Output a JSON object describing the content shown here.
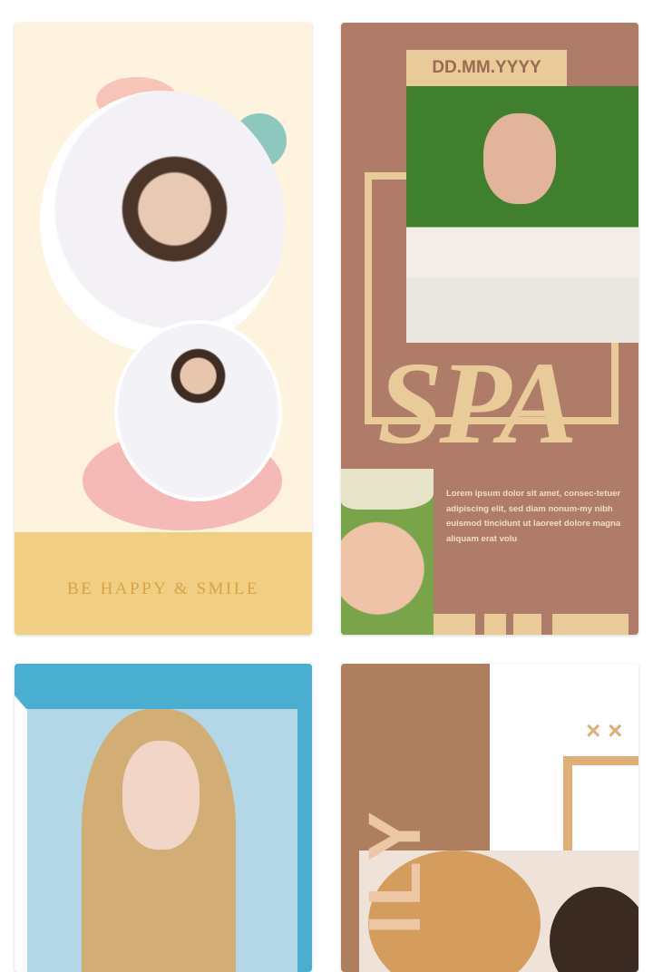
{
  "templates": [
    {
      "name": "be-happy",
      "caption": "BE HAPPY & SMILE",
      "colors": {
        "bg": "#fdf3de",
        "band": "#f0cf85",
        "text": "#d9a441"
      }
    },
    {
      "name": "spa",
      "date_placeholder": "DD.MM.YYYY",
      "title": "SPA",
      "body": "Lorem ipsum dolor sit amet, consec-tetuer adipiscing elit, sed diam nonum-my nibh euismod tincidunt ut laoreet dolore magna aliquam erat volu",
      "colors": {
        "bg": "#b07c6a",
        "accent": "#e8cb98"
      }
    },
    {
      "name": "blue-portrait",
      "colors": {
        "accent": "#4aaed0"
      }
    },
    {
      "name": "family",
      "title_fragment": "ILY",
      "marks": "× ×",
      "colors": {
        "panel": "#ad7f5e",
        "accent": "#dfaf78",
        "text": "#ecc7a6"
      }
    }
  ]
}
